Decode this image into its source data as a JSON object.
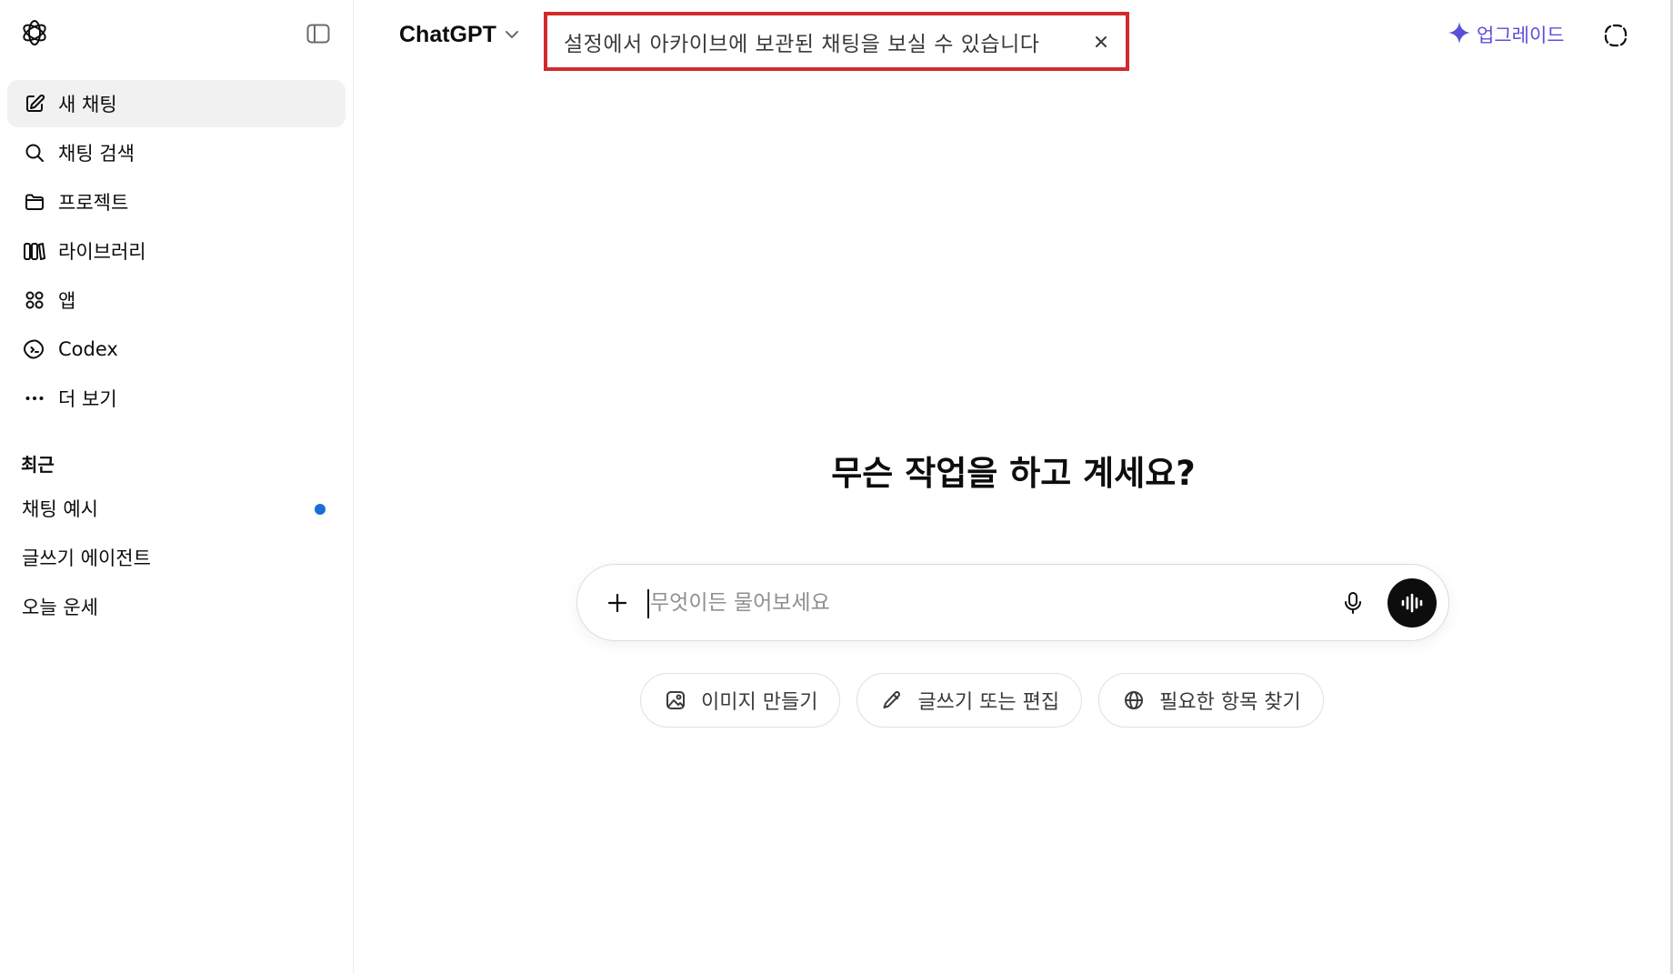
{
  "app": {
    "model_name": "ChatGPT"
  },
  "toast": {
    "message": "설정에서 아카이브에 보관된 채팅을 보실 수 있습니다",
    "close_symbol": "×"
  },
  "header": {
    "upgrade_label": "업그레이드"
  },
  "sidebar": {
    "items": [
      {
        "label": "새 채팅",
        "icon": "edit-icon"
      },
      {
        "label": "채팅 검색",
        "icon": "search-icon"
      },
      {
        "label": "프로젝트",
        "icon": "folder-icon"
      },
      {
        "label": "라이브러리",
        "icon": "library-icon"
      },
      {
        "label": "앱",
        "icon": "apps-icon"
      },
      {
        "label": "Codex",
        "icon": "codex-icon"
      },
      {
        "label": "더 보기",
        "icon": "more-icon"
      }
    ],
    "recent_title": "최근",
    "recent": [
      {
        "label": "채팅 예시",
        "unread": true
      },
      {
        "label": "글쓰기 에이전트",
        "unread": false
      },
      {
        "label": "오늘 운세",
        "unread": false
      }
    ]
  },
  "main": {
    "headline": "무슨 작업을 하고 계세요?",
    "composer_placeholder": "무엇이든 물어보세요",
    "composer_value": "",
    "chips": [
      {
        "label": "이미지 만들기",
        "icon": "image-icon"
      },
      {
        "label": "글쓰기 또는 편집",
        "icon": "pencil-icon"
      },
      {
        "label": "필요한 항목 찾기",
        "icon": "globe-icon"
      }
    ]
  },
  "colors": {
    "accent_purple": "#5b4fd8",
    "unread_dot": "#1a6fd6",
    "highlight_border": "#d22a2a",
    "active_item_bg": "#f1f1f1"
  }
}
